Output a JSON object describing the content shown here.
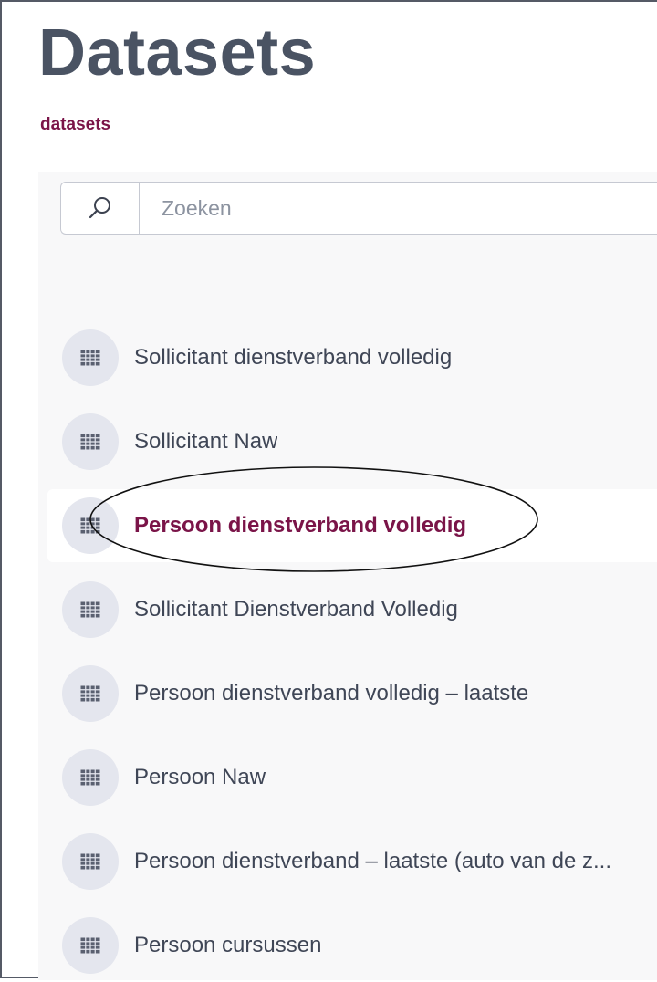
{
  "page": {
    "title": "Datasets",
    "breadcrumb": "datasets"
  },
  "search": {
    "placeholder": "Zoeken",
    "value": "",
    "icon": "search-icon"
  },
  "datasets": {
    "icon": "table-grid-icon",
    "items": [
      {
        "label": "Sollicitant dienstverband volledig",
        "active": false
      },
      {
        "label": "Sollicitant Naw",
        "active": false
      },
      {
        "label": "Persoon dienstverband volledig",
        "active": true
      },
      {
        "label": "Sollicitant Dienstverband Volledig",
        "active": false
      },
      {
        "label": "Persoon dienstverband volledig – laatste",
        "active": false
      },
      {
        "label": "Persoon Naw",
        "active": false
      },
      {
        "label": "Persoon dienstverband – laatste (auto van de z...",
        "active": false
      },
      {
        "label": "Persoon cursussen",
        "active": false
      }
    ]
  },
  "colors": {
    "title": "#4a5363",
    "accent": "#7a1448",
    "panel_background": "#f8f8f9",
    "icon_circle": "#e4e6ee",
    "icon_glyph": "#5a6070",
    "item_text": "#3f4656"
  }
}
